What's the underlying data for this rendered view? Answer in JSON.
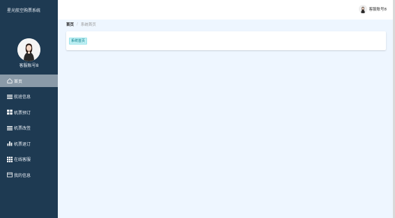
{
  "app": {
    "title": "星光航空购票系统"
  },
  "sidebar": {
    "user_name": "客服账号8",
    "items": [
      {
        "label": "首页",
        "icon": "home-icon",
        "active": true
      },
      {
        "label": "航班信息",
        "icon": "list-icon",
        "active": false
      },
      {
        "label": "机票预订",
        "icon": "grid-icon",
        "active": false
      },
      {
        "label": "机票改签",
        "icon": "list-icon",
        "active": false
      },
      {
        "label": "机票退订",
        "icon": "bar-chart-icon",
        "active": false
      },
      {
        "label": "在线客服",
        "icon": "apps-icon",
        "active": false
      },
      {
        "label": "我的信息",
        "icon": "card-icon",
        "active": false
      }
    ]
  },
  "header": {
    "user_name": "客服账号8"
  },
  "breadcrumb": {
    "home": "首页",
    "separator": "/",
    "current": "系统首页"
  },
  "main": {
    "tag_label": "系统首页"
  },
  "colors": {
    "sidebar": "#1e3a52",
    "active_item": "#8a9aa8",
    "background": "#eef6ff",
    "tag": "#bff0f4"
  }
}
